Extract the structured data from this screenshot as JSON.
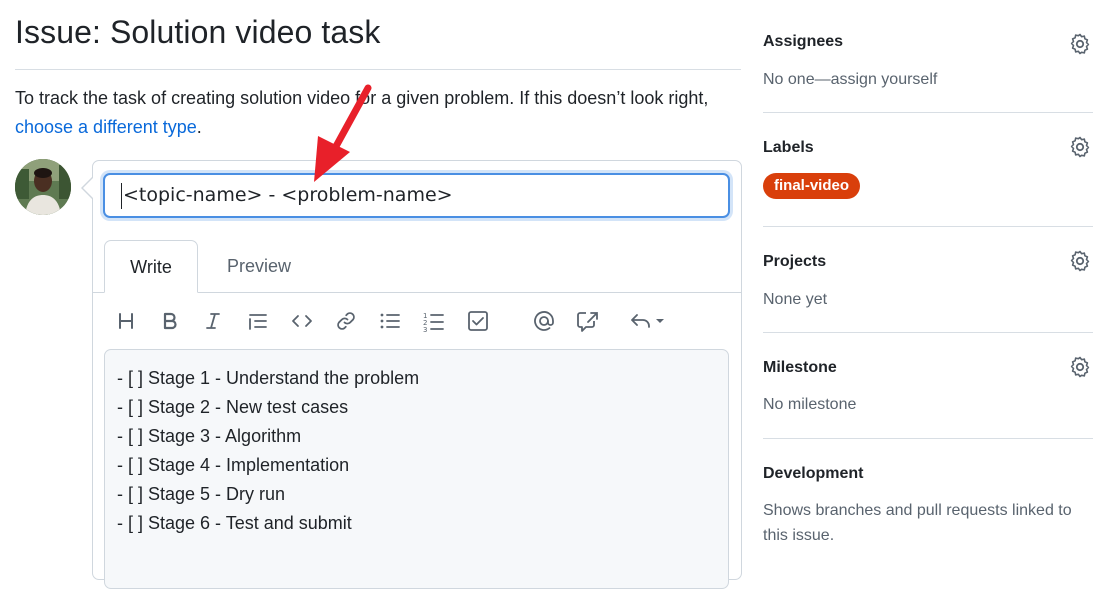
{
  "page": {
    "title": "Issue: Solution video task",
    "description_text": "To track the task of creating solution video for a given problem. If this doesn’t look right, ",
    "description_link": "choose a different type",
    "description_end": "."
  },
  "editor": {
    "title_value": "<topic-name> - <problem-name>",
    "tabs": [
      {
        "label": "Write",
        "active": true
      },
      {
        "label": "Preview",
        "active": false
      }
    ],
    "toolbar": [
      {
        "icon": "heading-icon",
        "glyph": "H"
      },
      {
        "icon": "bold-icon",
        "glyph": "B"
      },
      {
        "icon": "italic-icon",
        "glyph": "I"
      },
      {
        "icon": "quote-icon"
      },
      {
        "icon": "code-icon"
      },
      {
        "icon": "link-icon"
      },
      {
        "icon": "unordered-list-icon"
      },
      {
        "icon": "ordered-list-icon"
      },
      {
        "icon": "tasklist-icon"
      },
      {
        "icon": "mention-icon"
      },
      {
        "icon": "cross-reference-icon"
      },
      {
        "icon": "saved-replies-icon"
      }
    ],
    "body_lines": [
      "- [ ] Stage 1 - Understand the problem",
      "- [ ] Stage 2 - New test cases",
      "- [ ] Stage 3 - Algorithm",
      "- [ ] Stage 4 - Implementation",
      "- [ ] Stage 5 - Dry run",
      "- [ ] Stage 6 - Test and submit"
    ]
  },
  "sidebar": {
    "assignees": {
      "heading": "Assignees",
      "value": "No one—assign yourself"
    },
    "labels": {
      "heading": "Labels",
      "badge": "final-video",
      "badge_color": "#d93f0b"
    },
    "projects": {
      "heading": "Projects",
      "value": "None yet"
    },
    "milestone": {
      "heading": "Milestone",
      "value": "No milestone"
    },
    "development": {
      "heading": "Development",
      "value": "Shows branches and pull requests linked to this issue."
    }
  },
  "colors": {
    "accent": "#0969da",
    "annotation_arrow": "#e8202a"
  }
}
